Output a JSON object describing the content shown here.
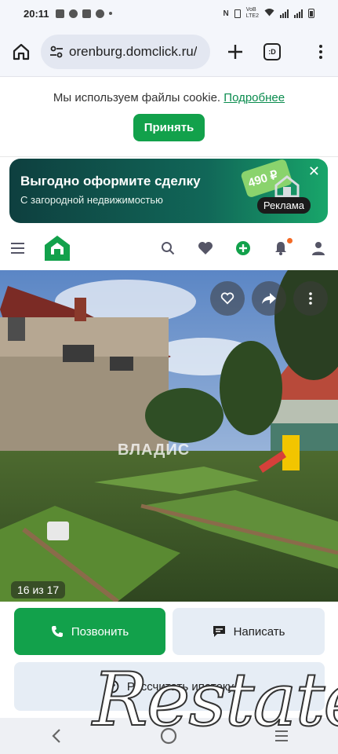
{
  "status_bar": {
    "time": "20:11",
    "network_label_top": "VoB",
    "network_label_bottom": "LTE2"
  },
  "browser": {
    "url": "orenburg.domclick.ru/",
    "tabs_label": ":D"
  },
  "cookie_banner": {
    "text": "Мы используем файлы cookie.",
    "link": "Подробнее",
    "accept": "Принять"
  },
  "ad": {
    "title": "Выгодно оформите сделку",
    "subtitle": "С загородной недвижимостью",
    "badge": "Реклама",
    "price_tag": "490 ₽",
    "close": "✕"
  },
  "photo": {
    "counter": "16 из 17",
    "watermark": "ВЛАДИС"
  },
  "actions": {
    "call": "Позвонить",
    "write": "Написать",
    "mortgage": "Рассчитать ипотеку"
  },
  "overlay": {
    "brand": "Restate"
  },
  "colors": {
    "accent": "#12a14b",
    "secondary_button": "#e6edf5",
    "notification": "#f36a26"
  }
}
